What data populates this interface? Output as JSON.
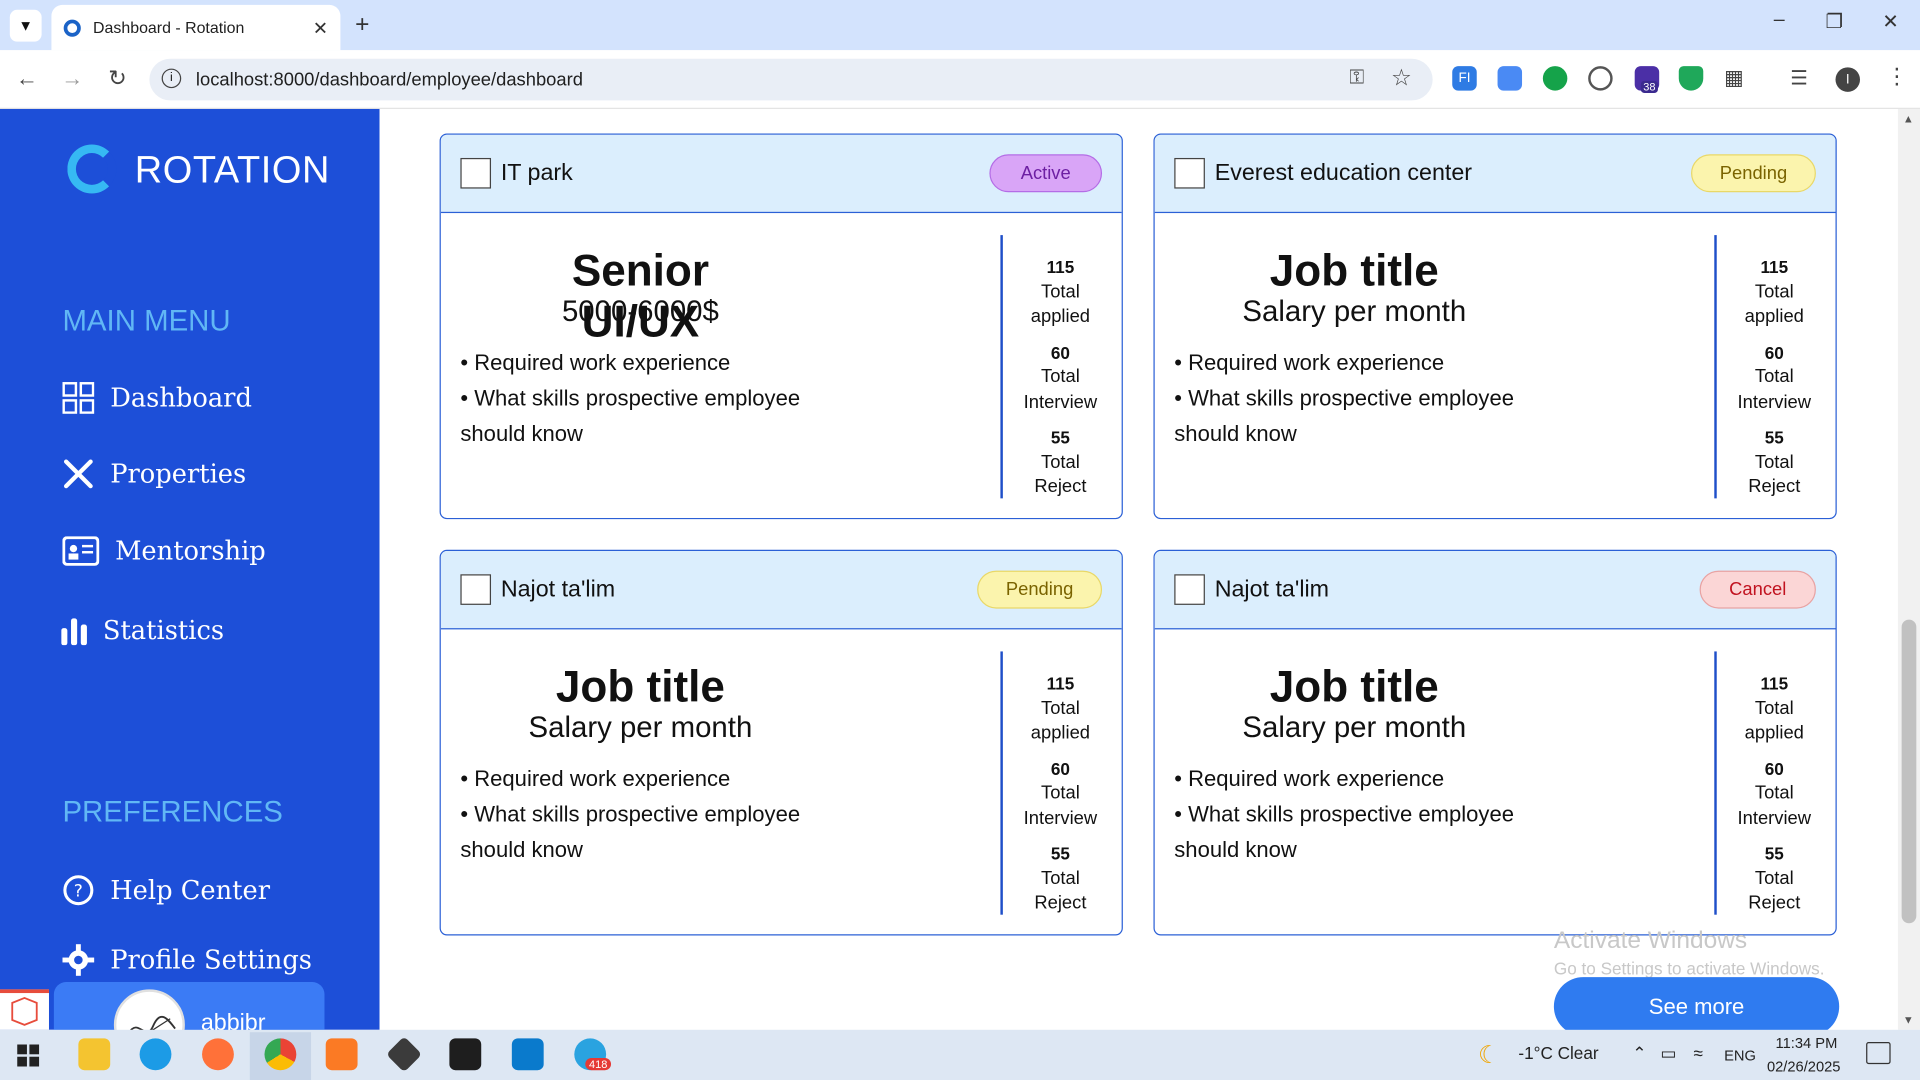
{
  "browser": {
    "tab_title": "Dashboard - Rotation",
    "url": "localhost:8000/dashboard/employee/dashboard",
    "ext_badge": "38"
  },
  "sidebar": {
    "brand": "ROTATION",
    "main_menu_title": "MAIN MENU",
    "main_items": [
      {
        "label": "Dashboard",
        "icon": "grid-icon"
      },
      {
        "label": "Properties",
        "icon": "tools-icon"
      },
      {
        "label": "Mentorship",
        "icon": "presentation-icon"
      },
      {
        "label": "Statistics",
        "icon": "bar-chart-icon"
      }
    ],
    "preferences_title": "PREFERENCES",
    "pref_items": [
      {
        "label": "Help Center",
        "icon": "question-icon"
      },
      {
        "label": "Profile Settings",
        "icon": "gear-icon"
      }
    ],
    "user_name": "abbibr"
  },
  "cards": [
    {
      "company": "IT park",
      "status": "Active",
      "title": "Senior UI/UX",
      "salary": "5000-6000$",
      "req1": "• Required work experience",
      "req2": "• What skills prospective employee should know",
      "applied_count": "115",
      "applied_l1": "Total",
      "applied_l2": "applied",
      "interview_count": "60",
      "interview_l1": "Total",
      "interview_l2": "Interview",
      "reject_count": "55",
      "reject_l1": "Total",
      "reject_l2": "Reject"
    },
    {
      "company": "Everest education center",
      "status": "Pending",
      "title": "Job title",
      "salary": "Salary per month",
      "req1": "• Required work experience",
      "req2": "• What skills prospective employee should know",
      "applied_count": "115",
      "applied_l1": "Total",
      "applied_l2": "applied",
      "interview_count": "60",
      "interview_l1": "Total",
      "interview_l2": "Interview",
      "reject_count": "55",
      "reject_l1": "Total",
      "reject_l2": "Reject"
    },
    {
      "company": "Najot ta'lim",
      "status": "Pending",
      "title": "Job title",
      "salary": "Salary per month",
      "req1": "• Required work experience",
      "req2": "• What skills prospective employee should know",
      "applied_count": "115",
      "applied_l1": "Total",
      "applied_l2": "applied",
      "interview_count": "60",
      "interview_l1": "Total",
      "interview_l2": "Interview",
      "reject_count": "55",
      "reject_l1": "Total",
      "reject_l2": "Reject"
    },
    {
      "company": "Najot ta'lim",
      "status": "Cancel",
      "title": "Job title",
      "salary": "Salary per month",
      "req1": "• Required work experience",
      "req2": "• What skills prospective employee should know",
      "applied_count": "115",
      "applied_l1": "Total",
      "applied_l2": "applied",
      "interview_count": "60",
      "interview_l1": "Total",
      "interview_l2": "Interview",
      "reject_count": "55",
      "reject_l1": "Total",
      "reject_l2": "Reject"
    }
  ],
  "see_more": "See more",
  "watermark": {
    "line1": "Activate Windows",
    "line2": "Go to Settings to activate Windows."
  },
  "taskbar": {
    "weather": "-1°C  Clear",
    "lang": "ENG",
    "time": "11:34 PM",
    "date": "02/26/2025",
    "telegram_badge": "418"
  },
  "colors": {
    "sidebar": "#1d4fd8",
    "section_title": "#61b7f5",
    "card_border": "#2b60d6",
    "card_header": "#dbeefd",
    "button": "#2f7bf0"
  }
}
